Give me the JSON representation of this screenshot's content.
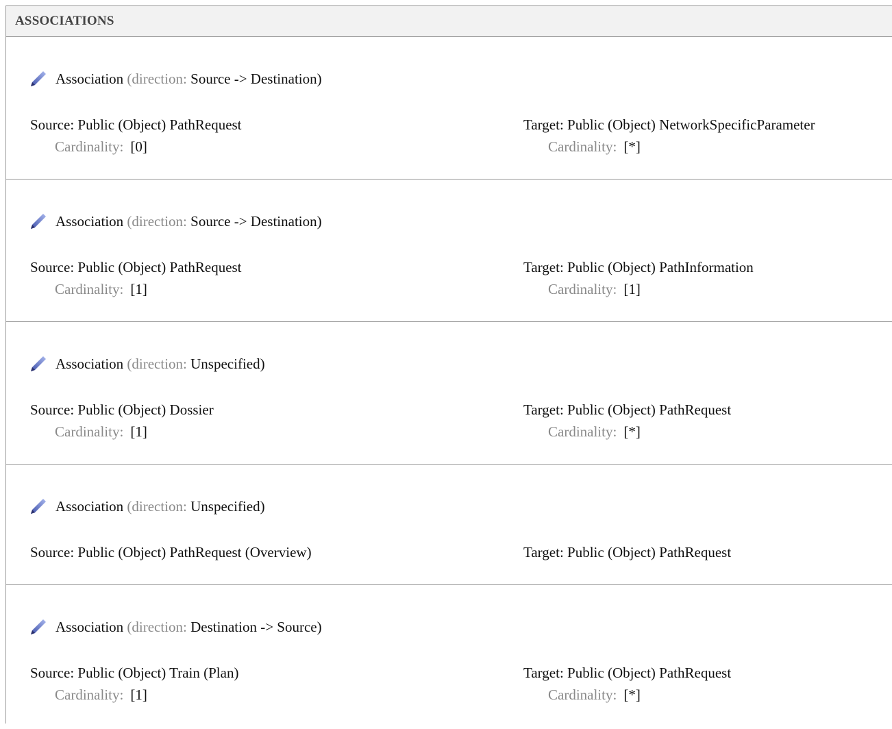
{
  "section_title": "ASSOCIATIONS",
  "direction_label": "direction:",
  "cardinality_label": "Cardinality:",
  "associations": [
    {
      "title": "Association",
      "direction": "Source -> Destination",
      "source": "Source: Public (Object) PathRequest",
      "source_cardinality": "[0]",
      "target": "Target: Public (Object) NetworkSpecificParameter",
      "target_cardinality": "[*]"
    },
    {
      "title": "Association",
      "direction": "Source -> Destination",
      "source": "Source: Public (Object) PathRequest",
      "source_cardinality": "[1]",
      "target": "Target: Public (Object) PathInformation",
      "target_cardinality": "[1]"
    },
    {
      "title": "Association",
      "direction": "Unspecified",
      "source": "Source: Public (Object) Dossier",
      "source_cardinality": "[1]",
      "target": "Target: Public (Object) PathRequest",
      "target_cardinality": "[*]"
    },
    {
      "title": "Association",
      "direction": "Unspecified",
      "source": "Source: Public (Object) PathRequest (Overview)",
      "target": "Target: Public (Object) PathRequest"
    },
    {
      "title": "Association",
      "direction": "Destination -> Source",
      "source": "Source: Public (Object) Train (Plan)",
      "source_cardinality": "[1]",
      "target": "Target: Public (Object) PathRequest",
      "target_cardinality": "[*]"
    }
  ]
}
